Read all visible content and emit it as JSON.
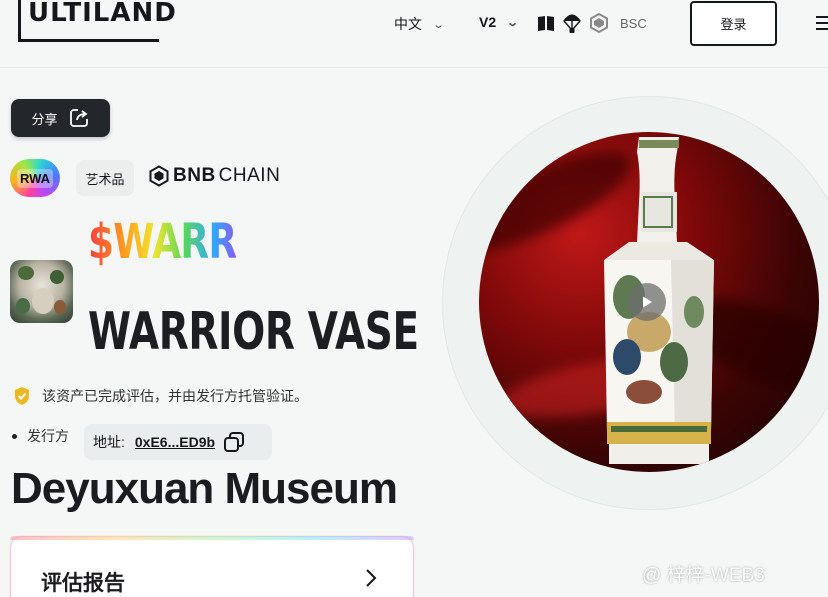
{
  "header": {
    "logo_text": "ULTILAND",
    "language": "中文",
    "version": "V2",
    "chain": "BSC",
    "login_label": "登录"
  },
  "share": {
    "label": "分享"
  },
  "tags": {
    "category": "RWA",
    "type": "艺术品",
    "chain_bold": "BNB",
    "chain_light": "CHAIN"
  },
  "token": {
    "ticker": "$WARR",
    "name": "WARRIOR VASE"
  },
  "verification": {
    "text": "该资产已完成评估，并由发行方托管验证。"
  },
  "issuer": {
    "label": "发行方",
    "address_label": "地址:",
    "address_value": "0xE6...ED9b",
    "name": "Deyuxuan Museum"
  },
  "report": {
    "title": "评估报告"
  },
  "watermark": {
    "text": "@ 梓梓-WEB3"
  },
  "colors": {
    "background": "#f4f7f6",
    "primary_dark": "#23272b",
    "verified_badge": "#e8b923"
  },
  "icons": [
    "share-icon",
    "book-icon",
    "parachute-icon",
    "bnb-icon",
    "copy-icon",
    "chevron-right-icon",
    "play-icon",
    "shield-check-icon",
    "menu-icon"
  ]
}
